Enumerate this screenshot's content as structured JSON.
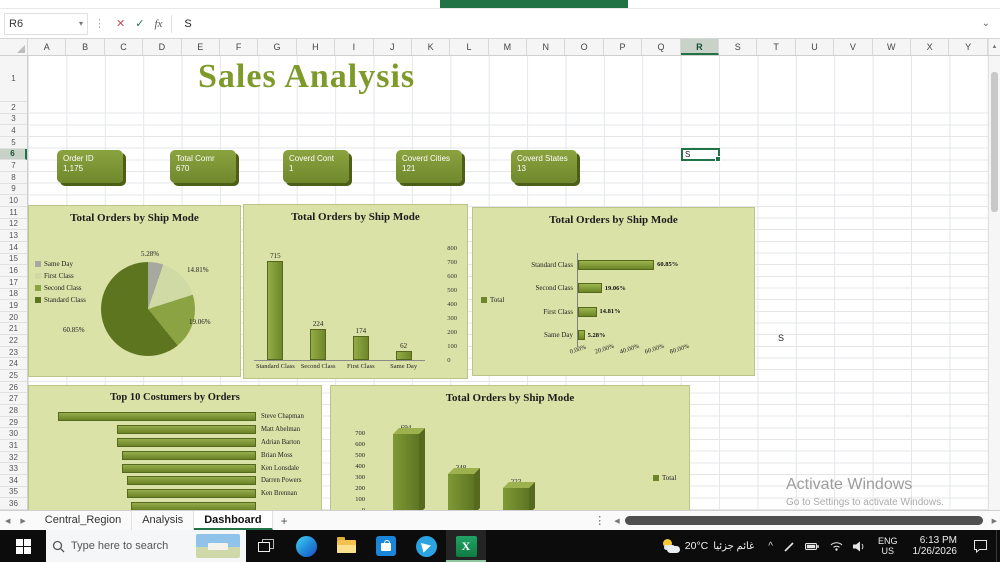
{
  "titlebar": {
    "accent_color": "#217346"
  },
  "formula_bar": {
    "name_box": "R6",
    "name_box_arrow": "▾",
    "menu_dots": "⋮",
    "cancel": "✕",
    "enter": "✓",
    "fx_label": "fx",
    "value": "S",
    "collapse": "⌄"
  },
  "sheet": {
    "columns": [
      "A",
      "B",
      "C",
      "D",
      "E",
      "F",
      "G",
      "H",
      "I",
      "J",
      "K",
      "L",
      "M",
      "N",
      "O",
      "P",
      "Q",
      "R",
      "S",
      "T",
      "U",
      "V",
      "W",
      "X",
      "Y"
    ],
    "selected_column": "R",
    "rows": 36,
    "selected_row": 6,
    "title": "Sales Analysis",
    "active_cell": {
      "ref": "R6",
      "text": "S"
    },
    "stray_text": "S",
    "scroll_up": "▲"
  },
  "kpi_cards": [
    {
      "label": "Order ID",
      "value": "1,175"
    },
    {
      "label": "Total Comr",
      "value": "670"
    },
    {
      "label": "Coverd Cont",
      "value": "1"
    },
    {
      "label": "Coverd Cities",
      "value": "121"
    },
    {
      "label": "Coverd States",
      "value": "13"
    }
  ],
  "chart_data": [
    {
      "type": "pie",
      "title": "Total Orders by Ship Mode",
      "labels": [
        "Same Day",
        "First Class",
        "Second Class",
        "Standard Class"
      ],
      "values": [
        5.28,
        14.81,
        19.06,
        60.85
      ],
      "data_labels": [
        "5.28%",
        "14.81%",
        "19.06%",
        "60.85%"
      ],
      "colors": [
        "#a8a99e",
        "#cfdaa4",
        "#8ca343",
        "#5d751f"
      ],
      "legend_position": "left"
    },
    {
      "type": "bar",
      "title": "Total Orders by Ship Mode",
      "categories": [
        "Standard Class",
        "Second Class",
        "First Class",
        "Same Day"
      ],
      "values": [
        715,
        224,
        174,
        62
      ],
      "ylim": [
        0,
        800
      ],
      "yticks": [
        800,
        700,
        600,
        500,
        400,
        300,
        200,
        100,
        0
      ],
      "axis_side": "right",
      "bar_color": "#7e9a33"
    },
    {
      "type": "hbar",
      "title": "Total Orders by Ship Mode",
      "legend": "Total",
      "categories": [
        "Standard Class",
        "Second Class",
        "First Class",
        "Same Day"
      ],
      "values": [
        60.85,
        19.06,
        14.81,
        5.28
      ],
      "data_labels": [
        "60.85%",
        "19.06%",
        "14.81%",
        "5.28%"
      ],
      "xticks": [
        "0.00%",
        "20.00%",
        "40.00%",
        "60.00%",
        "80.00%"
      ],
      "xlim": [
        0,
        80
      ],
      "bar_color": "#7e9a33"
    },
    {
      "type": "hbar",
      "title": "Top 10 Costumers by Orders",
      "categories": [
        "Steve Chapman",
        "Matt Abelman",
        "Adrian Barton",
        "Brian Moss",
        "Ken Lonsdale",
        "Darren Powers",
        "Ken Brennan",
        ""
      ],
      "values": [
        20,
        14,
        14,
        13.5,
        13.5,
        13,
        13,
        12.5
      ],
      "bar_color": "#7e9a33"
    },
    {
      "type": "bar3d",
      "title": "Total Orders by Ship Mode",
      "legend": "Total",
      "categories": [],
      "values": [
        694,
        348,
        223
      ],
      "ylim": [
        0,
        700
      ],
      "yticks": [
        700,
        600,
        500,
        400,
        300,
        200,
        100,
        0
      ],
      "bar_color": "#6e8729"
    }
  ],
  "watermark": {
    "line1": "Activate Windows",
    "line2": "Go to Settings to activate Windows."
  },
  "tabs": {
    "nav_left": "◀",
    "nav_right": "▶",
    "items": [
      "Central_Region",
      "Analysis",
      "Dashboard"
    ],
    "active": "Dashboard",
    "add_label": "+",
    "more": "⋮",
    "hscroll_left": "◀",
    "hscroll_right": "▶"
  },
  "taskbar": {
    "search_placeholder": "Type here to search",
    "apps": [
      "edge",
      "file-explorer",
      "store",
      "telegram",
      "excel"
    ],
    "active_app": "excel",
    "weather_temp": "20°C",
    "weather_desc": "غائم جزئيا",
    "tray_expand": "^",
    "lang_line1": "ENG",
    "lang_line2": "US",
    "time": "6:13 PM",
    "date": "1/26/2026"
  }
}
